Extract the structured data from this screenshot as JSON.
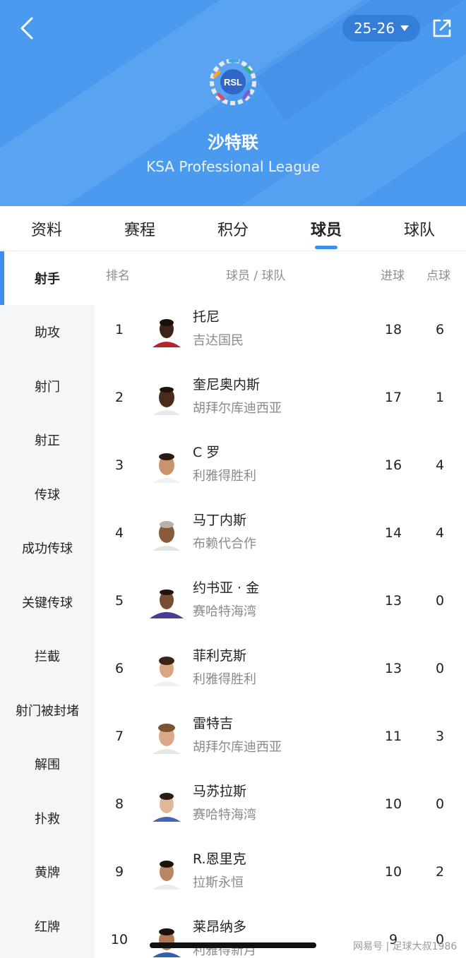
{
  "header": {
    "season": "25-26",
    "league_name": "沙特联",
    "league_en": "KSA Professional League",
    "logo_text": "RSL",
    "bg_color": "#4a9af0"
  },
  "tabs": [
    {
      "label": "资料"
    },
    {
      "label": "赛程"
    },
    {
      "label": "积分"
    },
    {
      "label": "球员",
      "active": true
    },
    {
      "label": "球队"
    }
  ],
  "sidebar": [
    {
      "label": "射手",
      "active": true
    },
    {
      "label": "助攻"
    },
    {
      "label": "射门"
    },
    {
      "label": "射正"
    },
    {
      "label": "传球"
    },
    {
      "label": "成功传球"
    },
    {
      "label": "关键传球"
    },
    {
      "label": "拦截"
    },
    {
      "label": "射门被封堵"
    },
    {
      "label": "解围"
    },
    {
      "label": "扑救"
    },
    {
      "label": "黄牌"
    },
    {
      "label": "红牌"
    }
  ],
  "table": {
    "headers": {
      "rank": "排名",
      "player_team": "球员 / 球队",
      "goals": "进球",
      "penalties": "点球"
    },
    "rows": [
      {
        "rank": "1",
        "name": "托尼",
        "team": "吉达国民",
        "goals": "18",
        "penalties": "6"
      },
      {
        "rank": "2",
        "name": "奎尼奥内斯",
        "team": "胡拜尔库迪西亚",
        "goals": "17",
        "penalties": "1"
      },
      {
        "rank": "3",
        "name": "C 罗",
        "team": "利雅得胜利",
        "goals": "16",
        "penalties": "4"
      },
      {
        "rank": "4",
        "name": "马丁内斯",
        "team": "布赖代合作",
        "goals": "14",
        "penalties": "4"
      },
      {
        "rank": "5",
        "name": "约书亚 · 金",
        "team": "赛哈特海湾",
        "goals": "13",
        "penalties": "0"
      },
      {
        "rank": "6",
        "name": "菲利克斯",
        "team": "利雅得胜利",
        "goals": "13",
        "penalties": "0"
      },
      {
        "rank": "7",
        "name": "雷特吉",
        "team": "胡拜尔库迪西亚",
        "goals": "11",
        "penalties": "3"
      },
      {
        "rank": "8",
        "name": "马苏拉斯",
        "team": "赛哈特海湾",
        "goals": "10",
        "penalties": "0"
      },
      {
        "rank": "9",
        "name": "R.恩里克",
        "team": "拉斯永恒",
        "goals": "10",
        "penalties": "2"
      },
      {
        "rank": "10",
        "name": "莱昂纳多",
        "team": "利雅得新月",
        "goals": "9",
        "penalties": "0"
      }
    ]
  },
  "watermark": "网易号 | 足球大叔1986"
}
